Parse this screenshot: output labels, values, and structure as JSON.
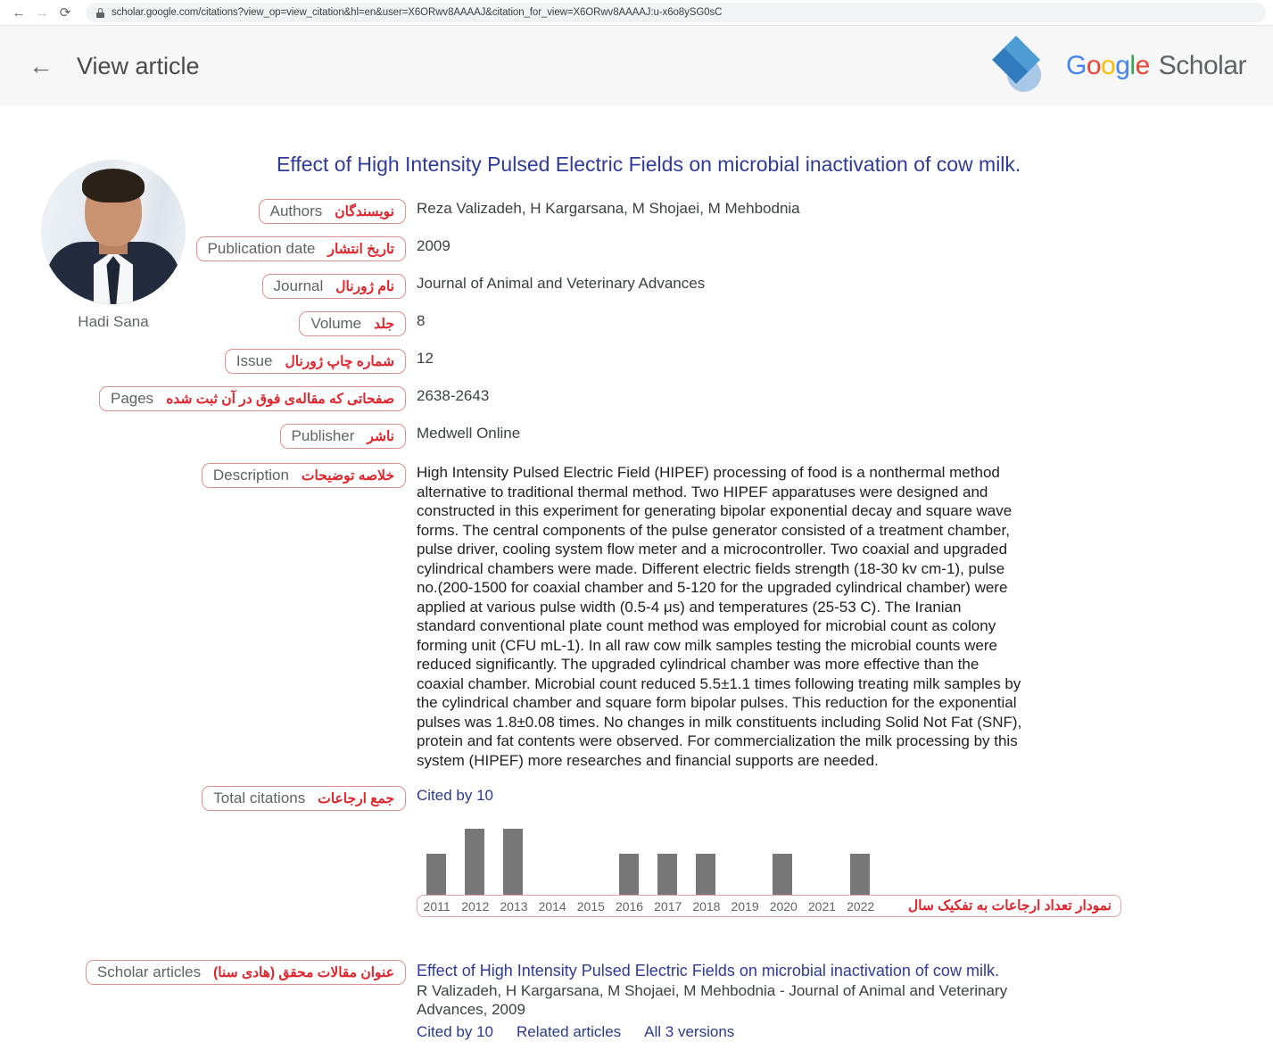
{
  "browser": {
    "back_icon": "back-arrow-icon",
    "forward_icon": "forward-arrow-icon",
    "reload_icon": "reload-icon",
    "lock_icon": "lock-icon",
    "url": "scholar.google.com/citations?view_op=view_citation&hl=en&user=X6ORwv8AAAAJ&citation_for_view=X6ORwv8AAAAJ:u-x6o8ySG0sC"
  },
  "header": {
    "back_label": "←",
    "title": "View article",
    "brand": {
      "g1": "G",
      "o1": "o",
      "o2": "o",
      "g2": "g",
      "l": "l",
      "e": "e",
      "scholar": "Scholar"
    }
  },
  "author": {
    "name": "Hadi Sana"
  },
  "article": {
    "title": "Effect of High Intensity Pulsed Electric Fields on microbial inactivation of cow milk."
  },
  "fields": [
    {
      "fa": "نویسندگان",
      "en": "Authors",
      "value": "Reza Valizadeh, H Kargarsana, M Shojaei, M Mehbodnia",
      "name": "authors"
    },
    {
      "fa": "تاریخ انتشار",
      "en": "Publication date",
      "value": "2009",
      "name": "publication-date"
    },
    {
      "fa": "نام ژورنال",
      "en": "Journal",
      "value": "Journal of Animal and Veterinary Advances",
      "name": "journal"
    },
    {
      "fa": "جلد",
      "en": "Volume",
      "value": "8",
      "name": "volume"
    },
    {
      "fa": "شماره چاپ ژورنال",
      "en": "Issue",
      "value": "12",
      "name": "issue"
    },
    {
      "fa": "صفحاتی که مقاله‌ی فوق در آن ثبت شده",
      "en": "Pages",
      "value": "2638-2643",
      "name": "pages"
    },
    {
      "fa": "ناشر",
      "en": "Publisher",
      "value": "Medwell Online",
      "name": "publisher"
    }
  ],
  "description": {
    "fa": "خلاصه توضیحات",
    "en": "Description",
    "text": "High Intensity Pulsed Electric Field (HIPEF) processing of food is a nonthermal method alternative to traditional thermal method. Two HIPEF apparatuses were designed and constructed in this experiment for generating bipolar exponential decay and square wave forms. The central components of the pulse generator consisted of a treatment chamber, pulse driver, cooling system flow meter and a microcontroller. Two coaxial and upgraded cylindrical chambers were made. Different electric fields strength (18-30 kv cm-1), pulse no.(200-1500 for coaxial chamber and 5-120 for the upgraded cylindrical chamber) were applied at various pulse width (0.5-4 μs) and temperatures (25-53 C). The Iranian standard conventional plate count method was employed for microbial count as colony forming unit (CFU mL-1). In all raw cow milk samples testing the microbial counts were reduced significantly. The upgraded cylindrical chamber was more effective than the coaxial chamber. Microbial count reduced 5.5±1.1 times following treating milk samples by the cylindrical chamber and square form bipolar pulses. This reduction for the exponential pulses was 1.8±0.08 times. No changes in milk constituents including Solid Not Fat (SNF), protein and fat contents were observed. For commercialization the milk processing by this system (HIPEF) more researches and financial supports are needed."
  },
  "citations": {
    "fa": "جمع ارجاعات",
    "en": "Total citations",
    "cited_by": "Cited by 10",
    "chart_fa_label": "نمودار تعداد ارجاعات به تفکیک سال"
  },
  "scholar_articles": {
    "fa": "عنوان مقالات محقق (هادی سنا)",
    "en": "Scholar articles",
    "title": "Effect of High Intensity Pulsed Electric Fields on microbial inactivation of cow milk.",
    "meta": "R Valizadeh, H Kargarsana, M Shojaei, M Mehbodnia - Journal of Animal and Veterinary Advances, 2009",
    "links": [
      "Cited by 10",
      "Related articles",
      "All 3 versions"
    ]
  },
  "colors": {
    "annotation_red": "#e0262c",
    "annotation_border": "#e08f8f",
    "link_blue": "#2b3a8f",
    "bar_gray": "#777777"
  },
  "chart_data": {
    "type": "bar",
    "title": "Citations per year",
    "categories": [
      "2011",
      "2012",
      "2013",
      "2014",
      "2015",
      "2016",
      "2017",
      "2018",
      "2019",
      "2020",
      "2021",
      "2022"
    ],
    "values": [
      1,
      2,
      2,
      0,
      0,
      1,
      1,
      1,
      0,
      1,
      0,
      1
    ],
    "xlabel": "",
    "ylabel": "",
    "ylim": [
      0,
      2
    ],
    "grid": false,
    "legend": "none",
    "total": 10
  }
}
